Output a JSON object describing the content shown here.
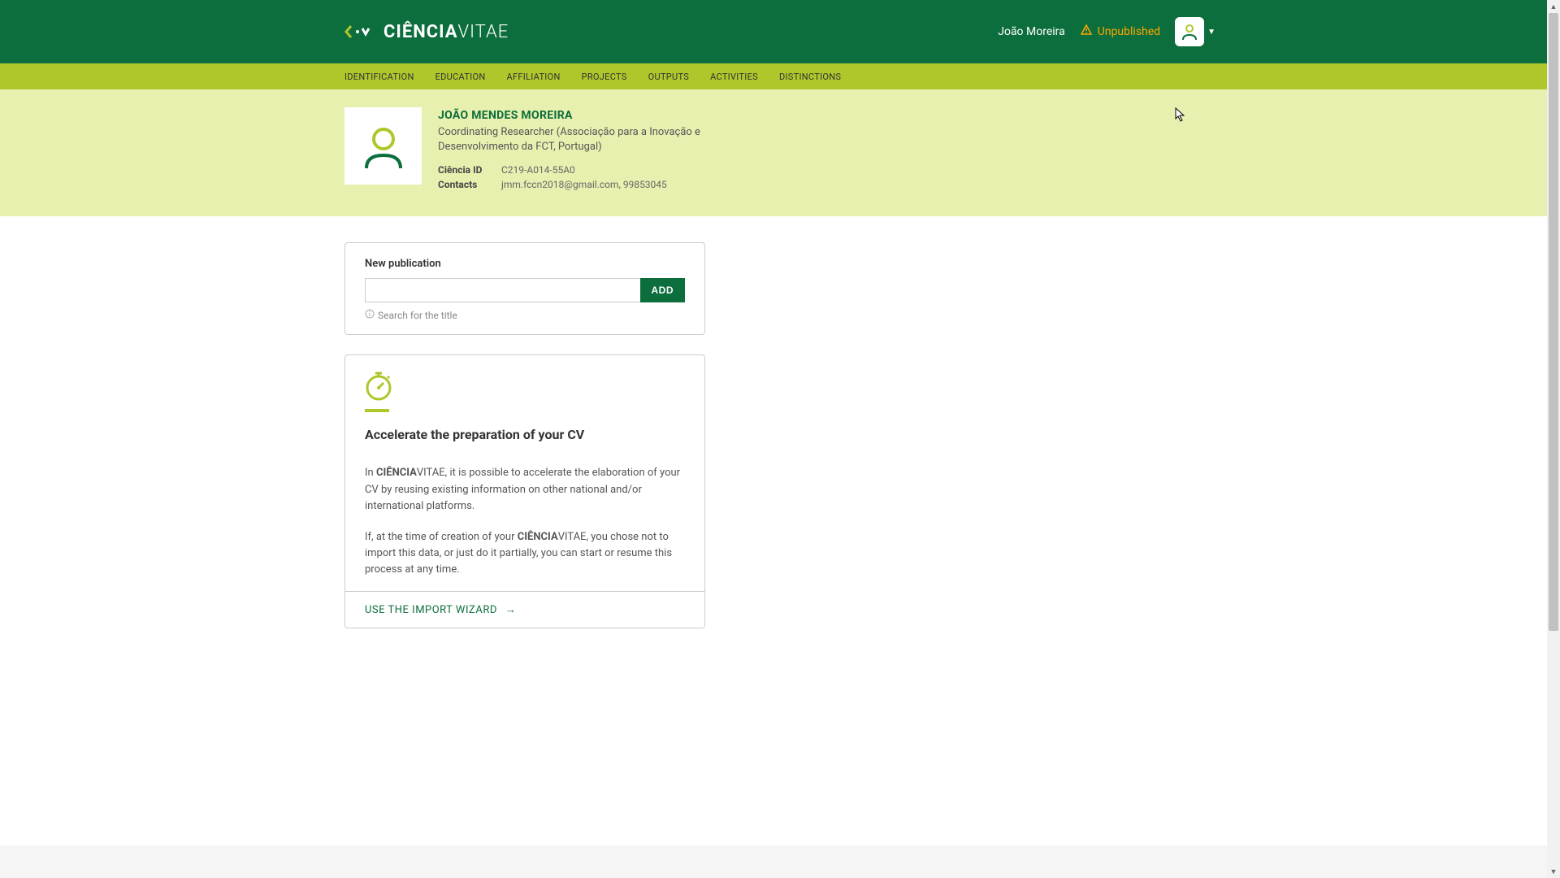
{
  "brand": {
    "bold": "CIÊNCIA",
    "light": "VITAE"
  },
  "header": {
    "user_name": "João Moreira",
    "unpublished": "Unpublished"
  },
  "nav": {
    "items": [
      "IDENTIFICATION",
      "EDUCATION",
      "AFFILIATION",
      "PROJECTS",
      "OUTPUTS",
      "ACTIVITIES",
      "DISTINCTIONS"
    ]
  },
  "profile": {
    "name": "JOÃO MENDES MOREIRA",
    "role": "Coordinating Researcher (Associação para a Inovação e Desenvolvimento da FCT, Portugal)",
    "ciencia_id_label": "Ciência ID",
    "ciencia_id": "C219-A014-55A0",
    "contacts_label": "Contacts",
    "contacts": "jmm.fccn2018@gmail.com, 99853045"
  },
  "new_publication": {
    "label": "New publication",
    "add": "ADD",
    "hint": "Search for the title"
  },
  "accelerate": {
    "title": "Accelerate the preparation of your CV",
    "p1_pre": "In ",
    "p1_bold": "CIÊNCIA",
    "p1_light": "VITAE",
    "p1_post": ", it is possible to accelerate the elaboration of your CV by reusing existing information on other national and/or international platforms.",
    "p2_pre": "If, at the time of creation of your ",
    "p2_bold": "CIÊNCIA",
    "p2_light": "VITAE",
    "p2_post": ", you chose not to import this data, or just do it partially, you can start or resume this process at any time.",
    "footer_link": "USE THE IMPORT WIZARD"
  }
}
